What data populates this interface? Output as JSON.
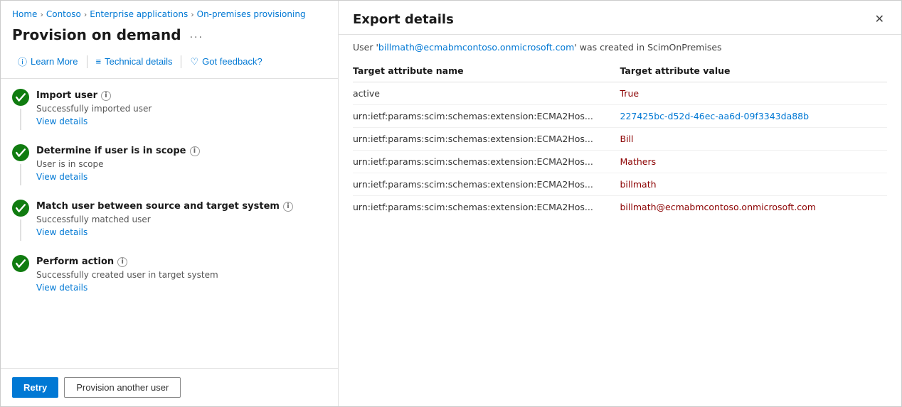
{
  "breadcrumb": {
    "items": [
      {
        "label": "Home",
        "id": "home"
      },
      {
        "label": "Contoso",
        "id": "contoso"
      },
      {
        "label": "Enterprise applications",
        "id": "enterprise-apps"
      },
      {
        "label": "On-premises provisioning",
        "id": "on-prem-provisioning"
      }
    ]
  },
  "left_panel": {
    "page_title": "Provision on demand",
    "ellipsis_label": "...",
    "toolbar": {
      "learn_more": "Learn More",
      "technical_details": "Technical details",
      "got_feedback": "Got feedback?"
    },
    "steps": [
      {
        "title": "Import user",
        "desc": "Successfully imported user",
        "view_details": "View details"
      },
      {
        "title": "Determine if user is in scope",
        "desc": "User is in scope",
        "view_details": "View details"
      },
      {
        "title": "Match user between source and target system",
        "desc": "Successfully matched user",
        "view_details": "View details"
      },
      {
        "title": "Perform action",
        "desc": "Successfully created user in target system",
        "view_details": "View details"
      }
    ],
    "footer": {
      "retry_label": "Retry",
      "provision_another_label": "Provision another user"
    }
  },
  "right_panel": {
    "title": "Export details",
    "close_icon": "✕",
    "subtitle_prefix": "User '",
    "subtitle_user": "billmath@ecmabmcontoso.onmicrosoft.com",
    "subtitle_suffix": "' was created in ScimOnPremises",
    "table": {
      "col_name": "Target attribute name",
      "col_value": "Target attribute value",
      "rows": [
        {
          "name": "active",
          "value": "True",
          "value_style": "red"
        },
        {
          "name": "urn:ietf:params:scim:schemas:extension:ECMA2Hos...",
          "value": "227425bc-d52d-46ec-aa6d-09f3343da88b",
          "value_style": "blue"
        },
        {
          "name": "urn:ietf:params:scim:schemas:extension:ECMA2Hos...",
          "value": "Bill",
          "value_style": "red"
        },
        {
          "name": "urn:ietf:params:scim:schemas:extension:ECMA2Hos...",
          "value": "Mathers",
          "value_style": "red"
        },
        {
          "name": "urn:ietf:params:scim:schemas:extension:ECMA2Hos...",
          "value": "billmath",
          "value_style": "red"
        },
        {
          "name": "urn:ietf:params:scim:schemas:extension:ECMA2Hos...",
          "value": "billmath@ecmabmcontoso.onmicrosoft.com",
          "value_style": "red"
        }
      ]
    }
  }
}
